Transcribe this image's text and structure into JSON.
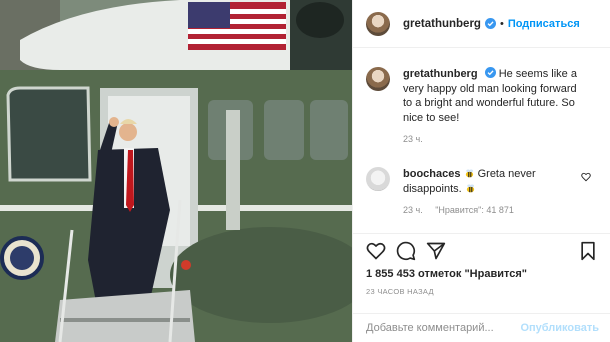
{
  "post": {
    "username": "gretathunberg",
    "follow_label": "Подписаться",
    "caption_username": "gretathunberg",
    "caption_text": "He seems like a very happy old man looking forward to a bright and wonderful future. So nice to see!",
    "caption_time": "23 ч.",
    "comment": {
      "username": "boochaces",
      "text": "Greta never disappoints.",
      "time": "23 ч.",
      "likes": "\"Нравится\": 41 871"
    },
    "likes_count": "1 855 453 отметок \"Нравится\"",
    "posted_ago": "23 ЧАСОВ НАЗАД",
    "comment_placeholder": "Добавьте комментарий...",
    "publish_label": "Опубликовать"
  },
  "icons": [
    "verified-icon",
    "like-icon",
    "comment-icon",
    "share-icon",
    "bookmark-icon",
    "heart-small-icon",
    "bee-icon"
  ],
  "colors": {
    "link": "#0095f6",
    "publish_disabled": "#b2dffc",
    "verified": "#3897f0",
    "muted": "#8e8e8e"
  }
}
